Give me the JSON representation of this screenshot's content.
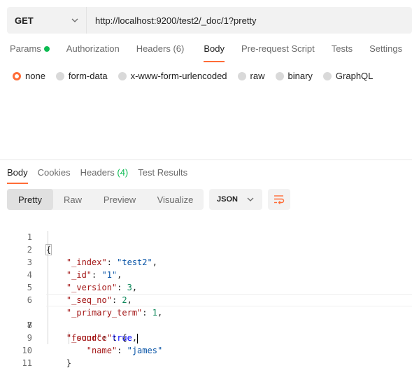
{
  "request": {
    "method": "GET",
    "url": "http://localhost:9200/test2/_doc/1?pretty"
  },
  "request_tabs": [
    {
      "label": "Params",
      "dot": true
    },
    {
      "label": "Authorization"
    },
    {
      "label": "Headers",
      "count": "(6)"
    },
    {
      "label": "Body",
      "active": true
    },
    {
      "label": "Pre-request Script"
    },
    {
      "label": "Tests"
    },
    {
      "label": "Settings"
    }
  ],
  "body_types": [
    {
      "label": "none",
      "selected": true
    },
    {
      "label": "form-data"
    },
    {
      "label": "x-www-form-urlencoded"
    },
    {
      "label": "raw"
    },
    {
      "label": "binary"
    },
    {
      "label": "GraphQL"
    }
  ],
  "response_tabs": [
    {
      "label": "Body",
      "active": true
    },
    {
      "label": "Cookies"
    },
    {
      "label": "Headers",
      "count": "(4)"
    },
    {
      "label": "Test Results"
    }
  ],
  "view_modes": [
    {
      "label": "Pretty",
      "active": true
    },
    {
      "label": "Raw"
    },
    {
      "label": "Preview"
    },
    {
      "label": "Visualize"
    }
  ],
  "format": "JSON",
  "line_numbers": [
    "1",
    "2",
    "3",
    "4",
    "5",
    "6",
    "7",
    "8",
    "9",
    "10",
    "11"
  ],
  "json_response": {
    "open": "{",
    "close": "}",
    "index_key": "\"_index\"",
    "index_val": "\"test2\"",
    "id_key": "\"_id\"",
    "id_val": "\"1\"",
    "version_key": "\"_version\"",
    "version_val": "3",
    "seq_key": "\"_seq_no\"",
    "seq_val": "2",
    "term_key": "\"_primary_term\"",
    "term_val": "1",
    "found_key": "\"found\"",
    "found_val": "true",
    "source_key": "\"_source\"",
    "source_open": "{",
    "name_key": "\"name\"",
    "name_val": "\"james\"",
    "source_close": "}"
  },
  "colors": {
    "accent": "#ff6c37",
    "success": "#0cbb52"
  },
  "icons": {
    "method_dropdown": "chevron-down-icon",
    "format_dropdown": "chevron-down-icon",
    "wrap": "wrap-lines-icon"
  }
}
